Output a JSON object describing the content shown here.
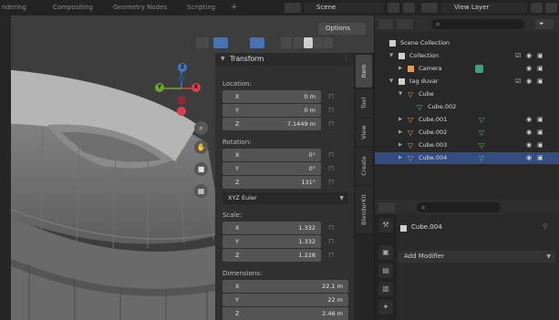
{
  "topbar": {
    "tabs": [
      "ndering",
      "Compositing",
      "Geometry Nodes",
      "Scripting"
    ],
    "plus": "+",
    "scene": "Scene",
    "view_layer": "View Layer"
  },
  "viewport": {
    "options_label": "Options",
    "gizmo": {
      "z": "Z",
      "y": "Y",
      "x": "X"
    }
  },
  "npanel": {
    "header": "Transform",
    "location_label": "Location:",
    "location": [
      {
        "axis": "X",
        "value": "0 m"
      },
      {
        "axis": "Y",
        "value": "0 m"
      },
      {
        "axis": "Z",
        "value": "7.1449 m"
      }
    ],
    "rotation_label": "Rotation:",
    "rotation": [
      {
        "axis": "X",
        "value": "0°"
      },
      {
        "axis": "Y",
        "value": "0°"
      },
      {
        "axis": "Z",
        "value": "131°"
      }
    ],
    "rotation_mode": "XYZ Euler",
    "scale_label": "Scale:",
    "scale": [
      {
        "axis": "X",
        "value": "1.332"
      },
      {
        "axis": "Y",
        "value": "1.332"
      },
      {
        "axis": "Z",
        "value": "1.228"
      }
    ],
    "dimensions_label": "Dimensions:",
    "dimensions": [
      {
        "axis": "X",
        "value": "22.1 m"
      },
      {
        "axis": "Y",
        "value": "22 m"
      },
      {
        "axis": "Z",
        "value": "2.46 m"
      }
    ]
  },
  "side_tabs": [
    "Item",
    "Tool",
    "View",
    "Create",
    "BlenderKit"
  ],
  "outliner": {
    "search_placeholder": "",
    "rows": [
      {
        "label": "Scene Collection"
      },
      {
        "label": "Collection"
      },
      {
        "label": "Camera"
      },
      {
        "label": "tag duvar"
      },
      {
        "label": "Cube"
      },
      {
        "label": "Cube.002"
      },
      {
        "label": "Cube.001"
      },
      {
        "label": "Cube.002"
      },
      {
        "label": "Cube.003"
      },
      {
        "label": "Cube.004"
      }
    ]
  },
  "properties": {
    "search_placeholder": "",
    "object_name": "Cube.004",
    "add_modifier": "Add Modifier"
  },
  "colors": {
    "accent": "#4772b3",
    "selection": "#334d80",
    "mesh_orange": "#e39a52",
    "mesh_green": "#5ec26c",
    "gizmo_x": "#d9404f",
    "gizmo_y": "#6aa82c",
    "gizmo_z": "#3c78c8"
  }
}
